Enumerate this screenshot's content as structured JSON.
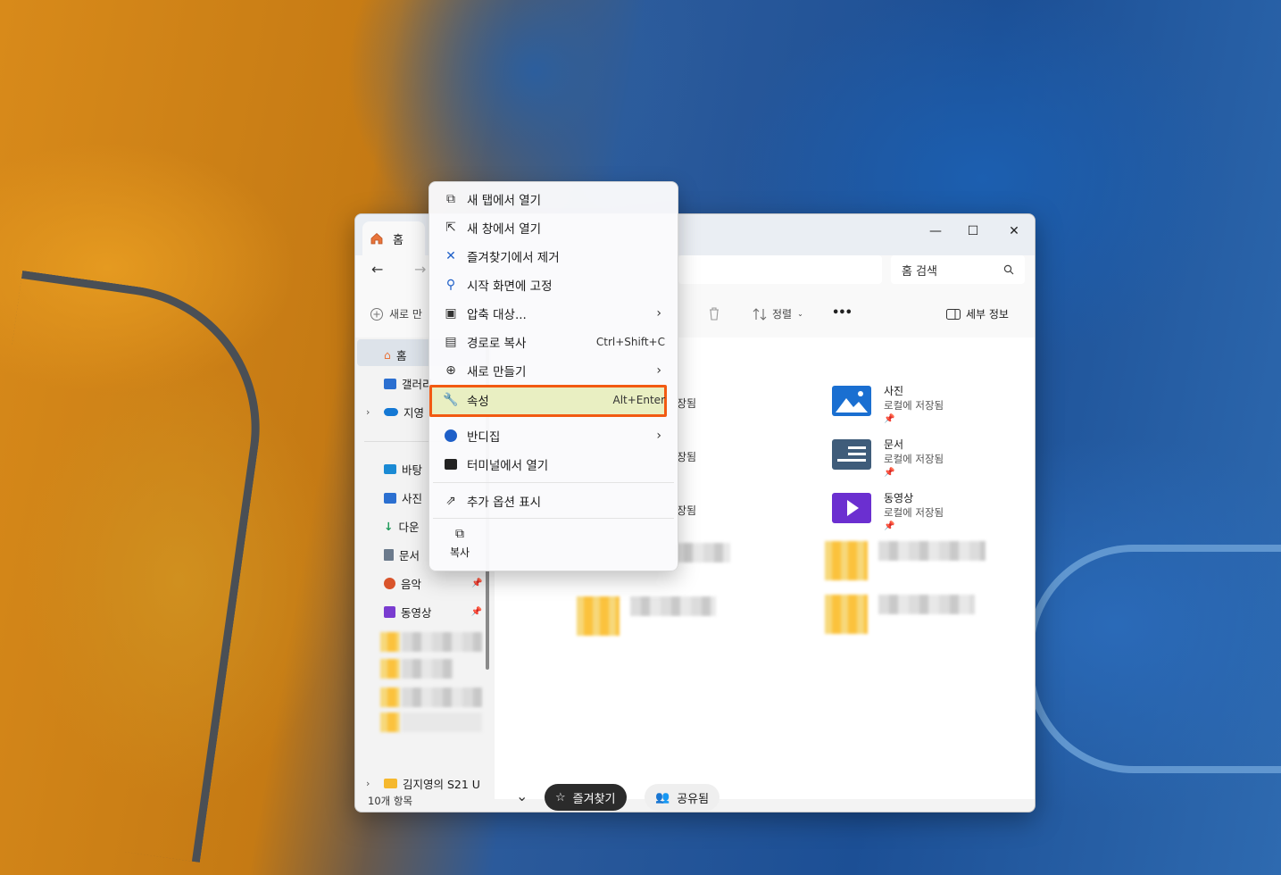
{
  "window": {
    "tab_label": "홈",
    "search_placeholder": "홈 검색",
    "minimize": "—",
    "maximize": "☐",
    "close": "✕"
  },
  "toolbar": {
    "new_label": "새로 만",
    "sort_label": "정렬",
    "details_label": "세부 정보",
    "more_label": "•••"
  },
  "sidebar": {
    "items": [
      {
        "label": "홈",
        "icon": "home-icon"
      },
      {
        "label": "갤러리",
        "icon": "gallery-icon"
      },
      {
        "label": "지영",
        "icon": "onedrive-icon"
      },
      {
        "label": "바탕",
        "icon": "desktop-icon"
      },
      {
        "label": "사진",
        "icon": "pictures-icon"
      },
      {
        "label": "다운",
        "icon": "download-icon"
      },
      {
        "label": "문서",
        "icon": "documents-icon"
      },
      {
        "label": "음악",
        "icon": "music-icon"
      },
      {
        "label": "동영상",
        "icon": "videos-icon"
      }
    ],
    "device_label": "김지영의 S21 U"
  },
  "status": {
    "item_count": "10개 항목"
  },
  "quick_access": [
    {
      "title": "사진",
      "sub": "로컬에 저장됨"
    },
    {
      "title": "문서",
      "sub": "로컬에 저장됨"
    },
    {
      "title": "동영상",
      "sub": "로컬에 저장됨"
    }
  ],
  "left_partial": [
    "장됨",
    "장됨",
    "장됨"
  ],
  "chips": {
    "favorites": "즐겨찾기",
    "shared": "공유됨"
  },
  "context_menu": {
    "items": [
      {
        "label": "새 탭에서 열기",
        "shortcut": ""
      },
      {
        "label": "새 창에서 열기",
        "shortcut": ""
      },
      {
        "label": "즐겨찾기에서 제거",
        "shortcut": ""
      },
      {
        "label": "시작 화면에 고정",
        "shortcut": ""
      },
      {
        "label": "압축 대상...",
        "shortcut": ""
      },
      {
        "label": "경로로 복사",
        "shortcut": "Ctrl+Shift+C"
      },
      {
        "label": "새로 만들기",
        "shortcut": ""
      },
      {
        "label": "속성",
        "shortcut": "Alt+Enter"
      },
      {
        "label": "반디집",
        "shortcut": ""
      },
      {
        "label": "터미널에서 열기",
        "shortcut": ""
      },
      {
        "label": "추가 옵션 표시",
        "shortcut": ""
      }
    ],
    "copy_label": "복사"
  },
  "colors": {
    "highlight_border": "#f25a12",
    "accent": "#005fb8"
  }
}
